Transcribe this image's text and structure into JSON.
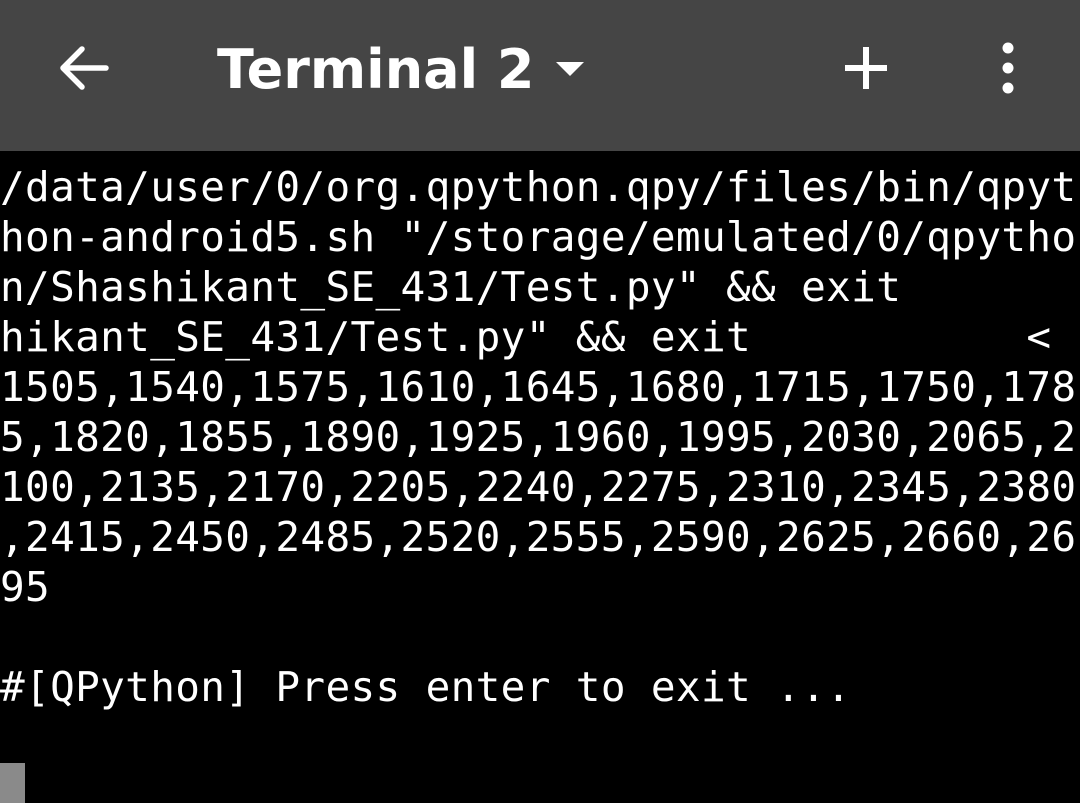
{
  "app_bar": {
    "title": "Terminal 2",
    "back_icon": "arrow-left-icon",
    "dropdown_icon": "caret-down-icon",
    "add_icon": "plus-icon",
    "more_icon": "more-vertical-icon",
    "background_color": "#454545",
    "foreground_color": "#ffffff"
  },
  "terminal": {
    "background_color": "#000000",
    "text_color": "#ffffff",
    "cursor_color": "#8a8a8a",
    "lines": [
      "/data/user/0/org.qpython.qpy/files/bin/qpyt",
      "hon-android5.sh \"/storage/emulated/0/qpytho",
      "n/Shashikant_SE_431/Test.py\" && exit",
      "hikant_SE_431/Test.py\" && exit           <",
      "1505,1540,1575,1610,1645,1680,1715,1750,178",
      "5,1820,1855,1890,1925,1960,1995,2030,2065,2",
      "100,2135,2170,2205,2240,2275,2310,2345,2380",
      ",2415,2450,2485,2520,2555,2590,2625,2660,26",
      "95",
      "",
      "#[QPython] Press enter to exit ..."
    ]
  }
}
